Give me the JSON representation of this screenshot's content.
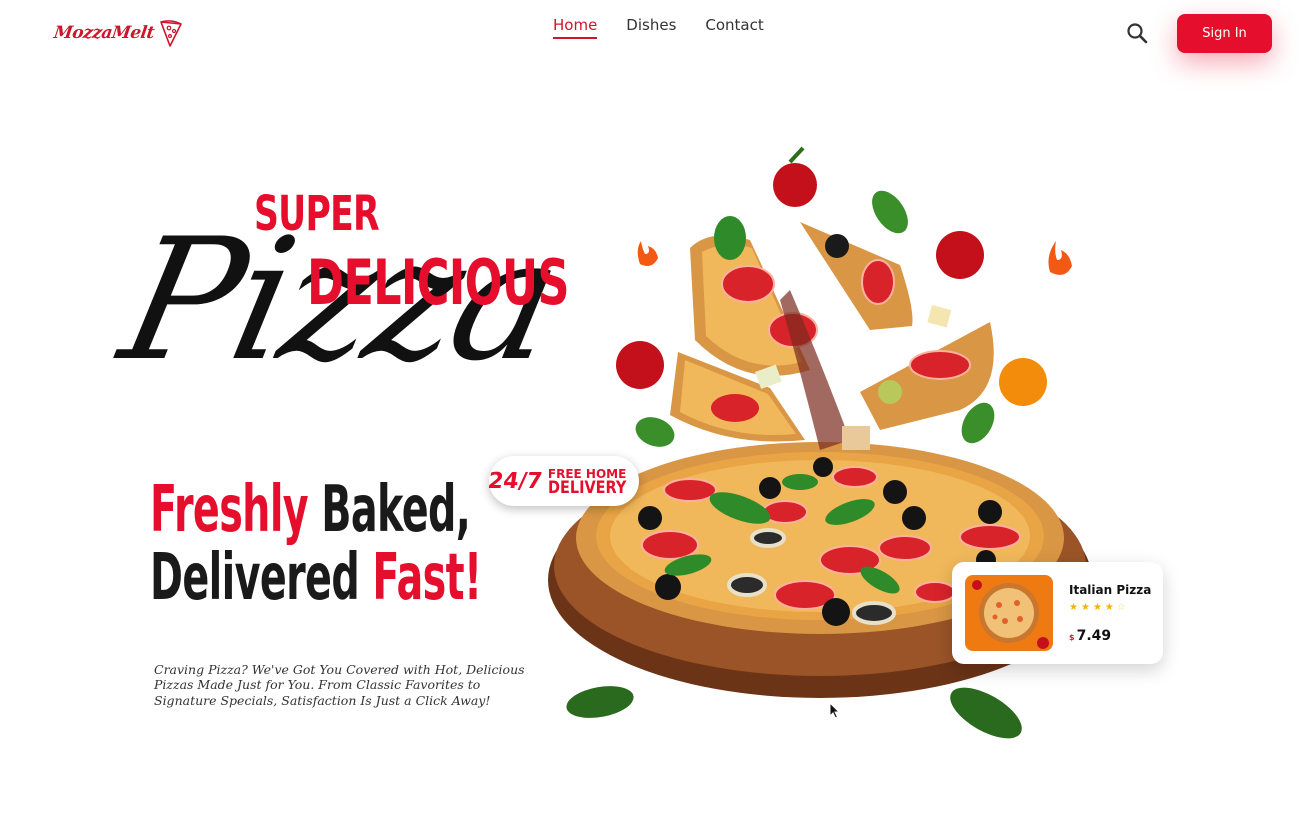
{
  "brand": {
    "name": "MozzaMelt"
  },
  "nav": {
    "items": [
      "Home",
      "Dishes",
      "Contact"
    ],
    "active": "Home"
  },
  "header": {
    "signin_label": "Sign In"
  },
  "hero": {
    "super": "SUPER",
    "delicious": "DELICIOUS",
    "pizza": "Pizza",
    "tagline_part1": "Freshly",
    "tagline_part2": " Baked,",
    "tagline_part3": "Delivered ",
    "tagline_part4": "Fast!",
    "description": "Craving Pizza? We've Got You Covered with Hot, Delicious Pizzas Made Just for You. From Classic Favorites to Signature Specials, Satisfaction Is Just a Click Away!"
  },
  "badge": {
    "hours": "24/7",
    "line1": "FREE HOME",
    "line2": "DELIVERY"
  },
  "card": {
    "name": "Italian Pizza",
    "rating_filled": 4,
    "rating_max": 5,
    "currency": "$",
    "price": "7.49"
  },
  "colors": {
    "accent": "#e50f2d",
    "text": "#1a1a1a",
    "star": "#f5b301"
  },
  "icons": [
    "pizza-slice-icon",
    "search-icon",
    "star-icon",
    "mouse-cursor-icon"
  ]
}
